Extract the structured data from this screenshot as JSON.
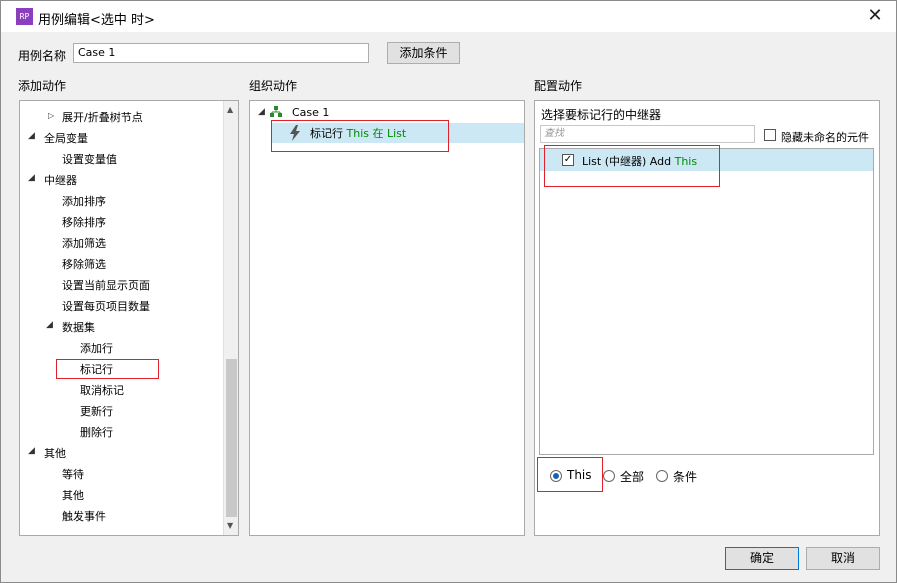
{
  "window": {
    "title": "用例编辑<选中 时>",
    "app_icon": "rp-app-icon",
    "close_glyph": "✕"
  },
  "case_name": {
    "label": "用例名称",
    "value": "Case 1",
    "add_condition": "添加条件"
  },
  "sections": {
    "add_action": "添加动作",
    "organize_action": "组织动作",
    "configure_action": "配置动作"
  },
  "action_tree": {
    "items": [
      {
        "label": "展开/折叠树节点"
      },
      {
        "label": "全局变量"
      },
      {
        "label": "设置变量值"
      },
      {
        "label": "中继器"
      },
      {
        "label": "添加排序"
      },
      {
        "label": "移除排序"
      },
      {
        "label": "添加筛选"
      },
      {
        "label": "移除筛选"
      },
      {
        "label": "设置当前显示页面"
      },
      {
        "label": "设置每页项目数量"
      },
      {
        "label": "数据集"
      },
      {
        "label": "添加行"
      },
      {
        "label": "标记行"
      },
      {
        "label": "取消标记"
      },
      {
        "label": "更新行"
      },
      {
        "label": "删除行"
      },
      {
        "label": "其他"
      },
      {
        "label": "等待"
      },
      {
        "label": "其他"
      },
      {
        "label": "触发事件"
      }
    ]
  },
  "organize": {
    "case_label": "Case 1",
    "action_prefix": "标记行",
    "action_this": "This",
    "action_in": "在",
    "action_target": "List"
  },
  "configure": {
    "heading": "选择要标记行的中继器",
    "search_placeholder": "查找",
    "hide_unnamed": "隐藏未命名的元件",
    "repeater_name": "List (中继器) Add",
    "repeater_this": "This",
    "options": {
      "this": "This",
      "all": "全部",
      "condition": "条件"
    }
  },
  "footer": {
    "ok": "确定",
    "cancel": "取消"
  },
  "colors": {
    "accent": "#1a5fb4",
    "selection": "#cce8f4",
    "highlight_box": "#e0202a",
    "green_text": "#008a00",
    "app_icon_bg": "#8b3fbf"
  }
}
